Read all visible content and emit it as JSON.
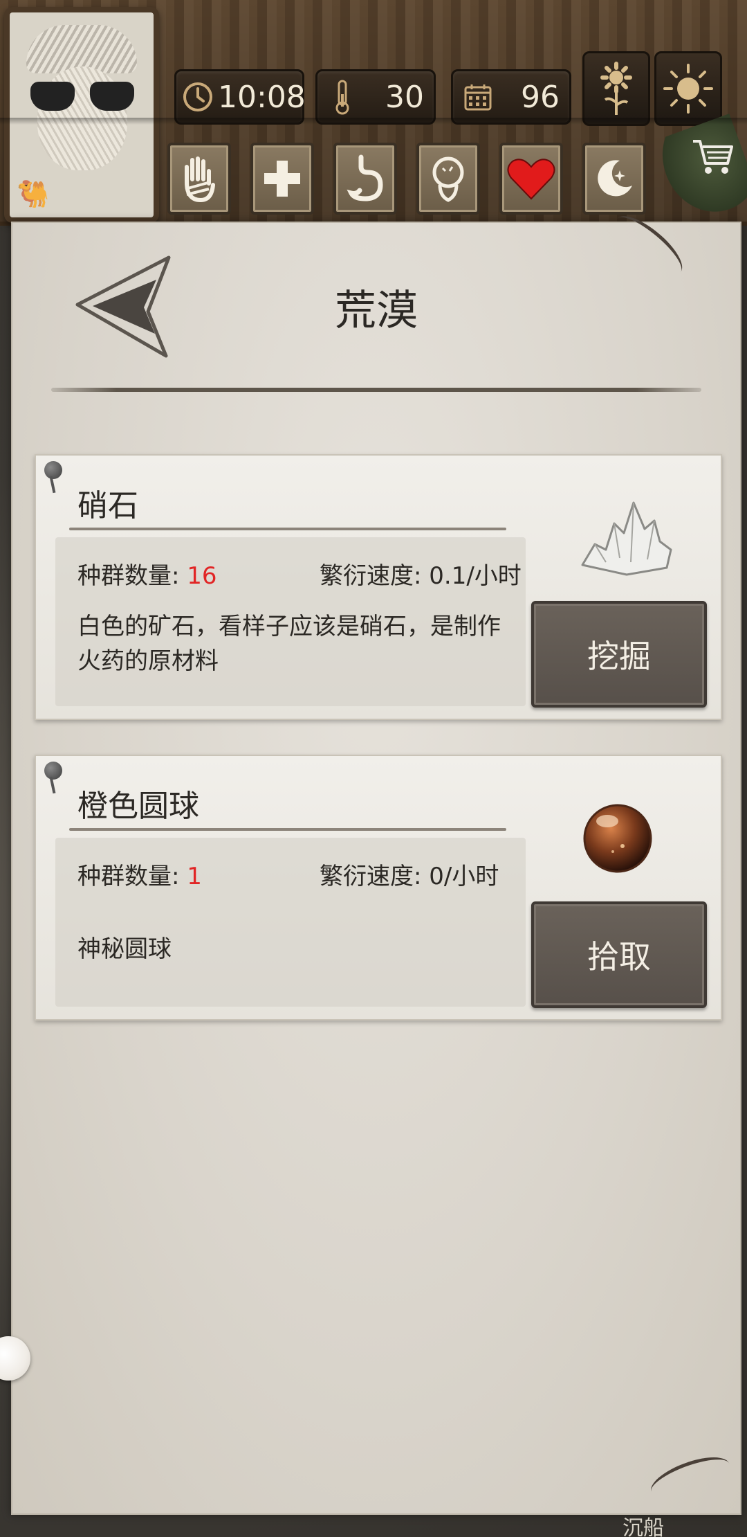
{
  "hud": {
    "time": "10:08",
    "temperature": "30",
    "day": "96",
    "weather_icons": [
      "sunflower-icon",
      "sun-icon"
    ],
    "status_icons": [
      "bandaged-hand-icon",
      "medical-cross-icon",
      "stomach-icon",
      "head-icon",
      "heart-icon",
      "moon-star-icon"
    ],
    "shop_icon": "cart-icon"
  },
  "page": {
    "title": "荒漠"
  },
  "items": [
    {
      "name": "硝石",
      "population_label": "种群数量: ",
      "population_value": "16",
      "growth_label": "繁衍速度: ",
      "growth_value": "0.1/小时",
      "description": "白色的矿石，看样子应该是硝石，是制作火药的原材料",
      "action": "挖掘",
      "icon": "saltpeter-crystal-icon"
    },
    {
      "name": "橙色圆球",
      "population_label": "种群数量: ",
      "population_value": "1",
      "growth_label": "繁衍速度: ",
      "growth_value": "0/小时",
      "description": "神秘圆球",
      "action": "拾取",
      "icon": "orange-orb-icon"
    }
  ],
  "colors": {
    "accent_red": "#e12525",
    "button": "#5f5851",
    "parchment": "#e6e2db",
    "wood": "#6b5238"
  },
  "footer": {
    "partial_text": "沉船"
  }
}
